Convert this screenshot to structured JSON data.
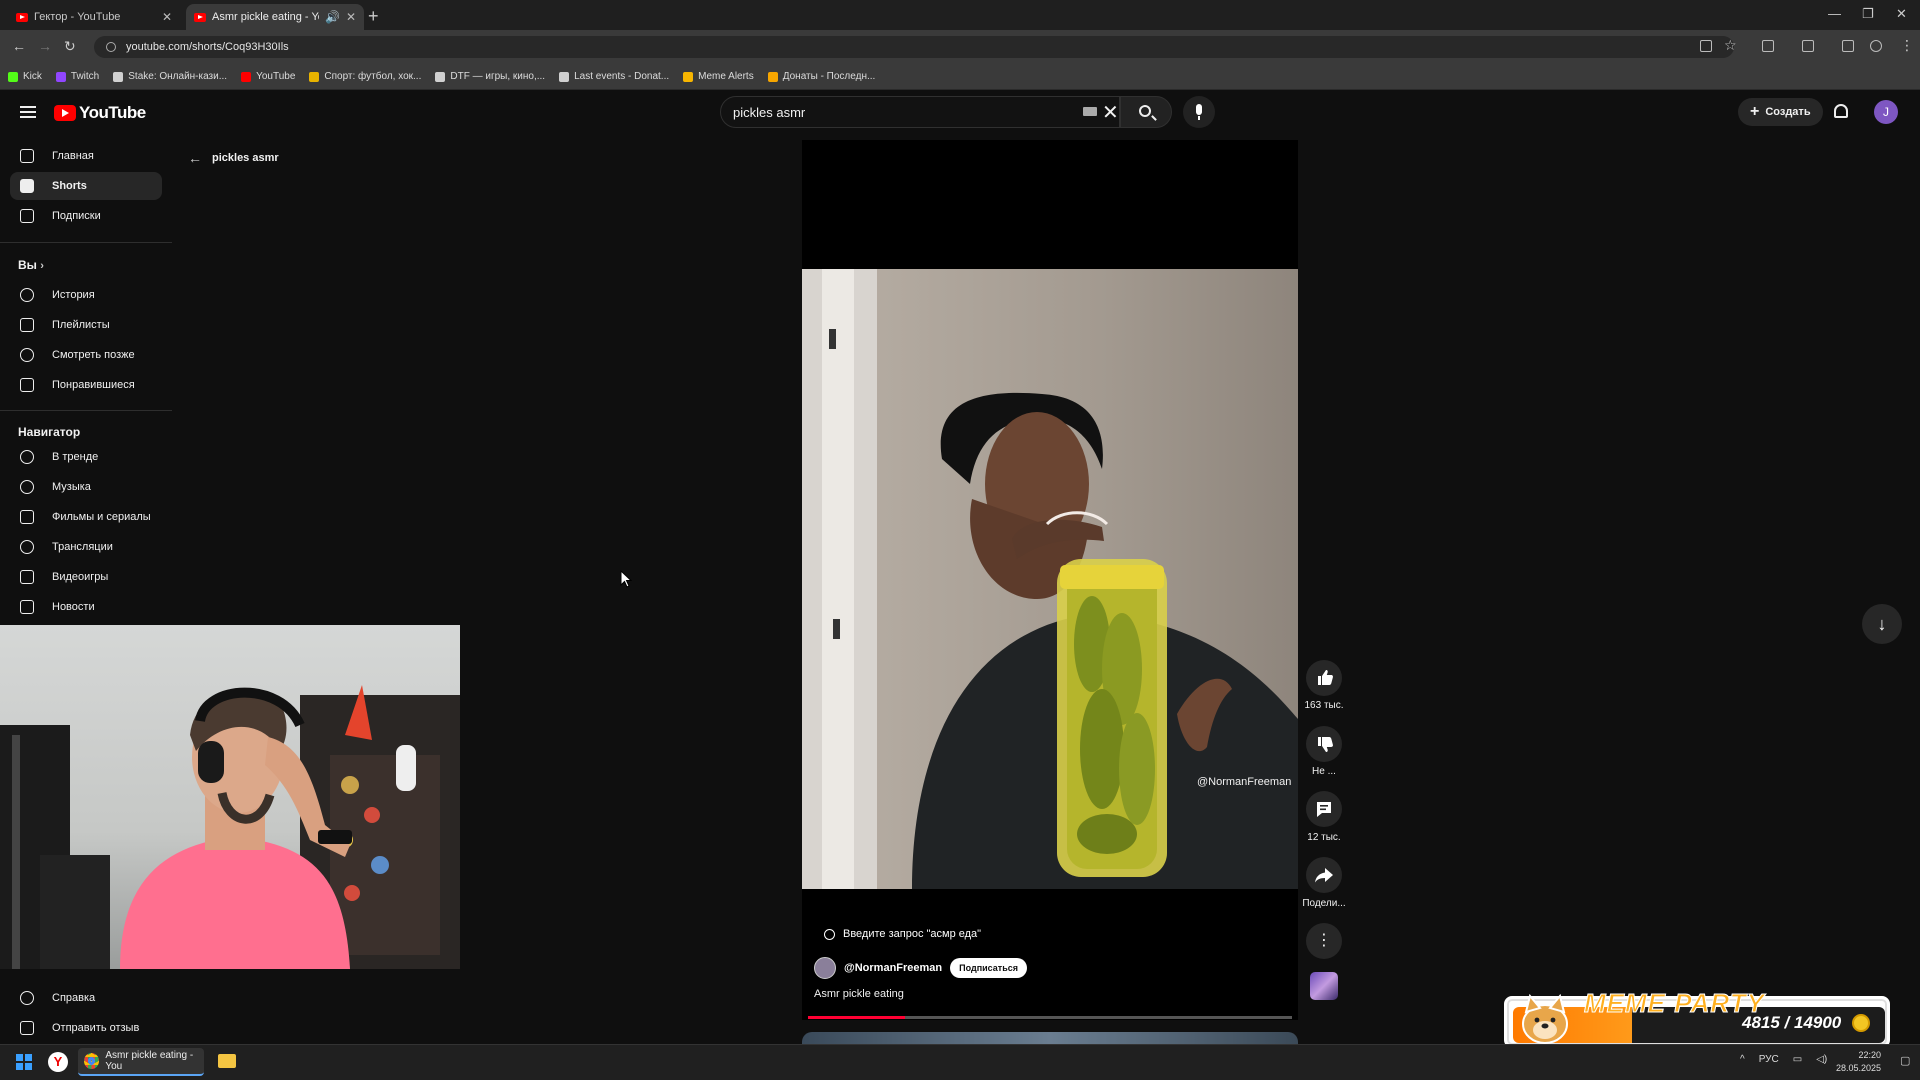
{
  "browser": {
    "tabs": [
      {
        "title": "Гектор - YouTube"
      },
      {
        "title": "Asmr pickle eating - YouTube"
      }
    ],
    "url": "youtube.com/shorts/Coq93H30Ils",
    "bookmarks": [
      {
        "label": "Kick",
        "color": "#53fc18"
      },
      {
        "label": "Twitch",
        "color": "#9146ff"
      },
      {
        "label": "Stake: Онлайн-кази...",
        "color": "#d0d0d0"
      },
      {
        "label": "YouTube",
        "color": "#ff0000"
      },
      {
        "label": "Спорт: футбол, хок...",
        "color": "#e8b300"
      },
      {
        "label": "DTF — игры, кино,...",
        "color": "#d0d0d0"
      },
      {
        "label": "Last events - Donat...",
        "color": "#d0d0d0"
      },
      {
        "label": "Meme Alerts",
        "color": "#f7b500"
      },
      {
        "label": "Донаты - Последн...",
        "color": "#f7a600"
      }
    ]
  },
  "youtube": {
    "logo": "YouTube",
    "search_value": "pickles asmr",
    "create_label": "Создать",
    "avatar_letter": "J"
  },
  "sidebar": {
    "main": [
      {
        "label": "Главная"
      },
      {
        "label": "Shorts"
      },
      {
        "label": "Подписки"
      }
    ],
    "you_header": "Вы",
    "you": [
      {
        "label": "История"
      },
      {
        "label": "Плейлисты"
      },
      {
        "label": "Смотреть позже"
      },
      {
        "label": "Понравившиеся"
      }
    ],
    "nav_header": "Навигатор",
    "nav": [
      {
        "label": "В тренде"
      },
      {
        "label": "Музыка"
      },
      {
        "label": "Фильмы и сериалы"
      },
      {
        "label": "Трансляции"
      },
      {
        "label": "Видеоигры"
      },
      {
        "label": "Новости"
      }
    ],
    "bottom": [
      {
        "label": "Справка"
      },
      {
        "label": "Отправить отзыв"
      }
    ]
  },
  "back": {
    "label": "pickles asmr"
  },
  "short": {
    "watermark": "@NormanFreeman",
    "overlay_search": "Введите запрос \"асмр еда\"",
    "channel": "@NormanFreeman",
    "subscribe": "Подписаться",
    "title": "Asmr pickle eating",
    "progress": 0.2,
    "likes": "163 тыс.",
    "dislike_label": "Не ...",
    "comments": "12 тыс.",
    "share_label": "Подели..."
  },
  "widget": {
    "title": "MEME PARTY",
    "count": "4815 / 14900",
    "progress": 0.32
  },
  "taskbar": {
    "chrome_task": "Asmr pickle eating - You",
    "lang": "РУС",
    "time": "22:20",
    "date": "28.05.2025"
  }
}
